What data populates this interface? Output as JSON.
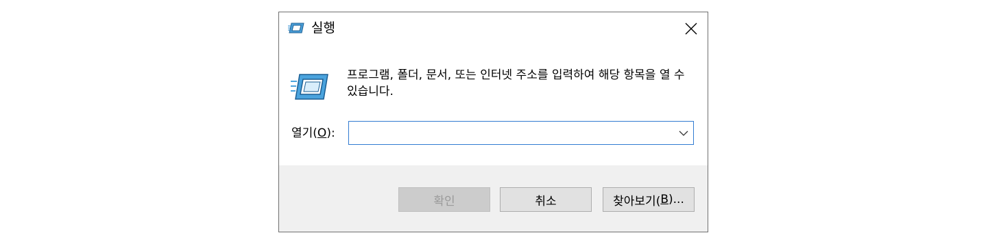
{
  "window": {
    "title": "실행",
    "close_symbol": "✕"
  },
  "content": {
    "description": "프로그램, 폴더, 문서, 또는 인터넷 주소를 입력하여 해당 항목을 열 수 있습니다.",
    "open_label_prefix": "열기(",
    "open_label_key": "O",
    "open_label_suffix": "):",
    "open_value": "",
    "icon": "run-icon"
  },
  "buttons": {
    "ok": "확인",
    "cancel": "취소",
    "browse_prefix": "찾아보기(",
    "browse_key": "B",
    "browse_suffix": ")..."
  },
  "colors": {
    "accent_border": "#2f7ad1",
    "footer_bg": "#f0f0f0",
    "button_bg": "#e1e1e1"
  }
}
